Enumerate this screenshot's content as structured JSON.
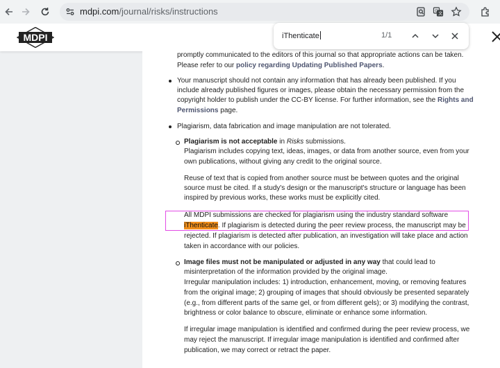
{
  "browser": {
    "url_host": "mdpi.com",
    "url_path": "/journal/risks/instructions",
    "icons": [
      "back-arrow-icon",
      "forward-arrow-icon",
      "reload-icon",
      "site-info-icon",
      "page-search-icon",
      "translate-icon",
      "bookmark-star-icon",
      "extensions-puzzle-icon"
    ]
  },
  "site": {
    "logo_text": "MDPI"
  },
  "find_bar": {
    "query": "iThenticate",
    "count": "1/1"
  },
  "content": {
    "p0_l1": "promptly communicated to the editors of this journal so that appropriate actions can be taken.",
    "p0_l2_pre": "Please refer to our ",
    "p0_l2_link": "policy regarding Updating Published Papers",
    "p0_l2_post": ".",
    "b1_l1": "Your manuscript should not contain any information that has already been published. If you",
    "b1_l2": "include already published figures or images, please obtain the necessary permission from the",
    "b1_l3_pre": "copyright holder to publish under the CC-BY license. For further information, see the ",
    "b1_l3_link": "Rights and",
    "b1_l4_link": "Permissions",
    "b1_l4_post": " page.",
    "b2_l1": "Plagiarism, data fabrication and image manipulation are not tolerated.",
    "s1_l1_bold": "Plagiarism is not acceptable",
    "s1_l1_mid": " in ",
    "s1_l1_ital": "Risks",
    "s1_l1_post": " submissions.",
    "s1_l2": "Plagiarism includes copying text, ideas, images, or data from another source, even from your",
    "s1_l3": "own publications, without giving any credit to the original source.",
    "s1_p2_l1": "Reuse of text that is copied from another source must be between quotes and the original",
    "s1_p2_l2": "source must be cited. If a study's design or the manuscript's structure or language has been",
    "s1_p2_l3": "inspired by previous works, these works must be explicitly cited.",
    "s1_p3_l1": "All MDPI submissions are checked for plagiarism using the industry standard software",
    "s1_p3_l2_match": "iThenticate",
    "s1_p3_l2_post": ". If plagiarism is detected during the peer review process, the manuscript may be",
    "s1_p3_l3": "rejected. If plagiarism is detected after publication, an investigation will take place and action",
    "s1_p3_l4": "taken in accordance with our policies.",
    "s2_l1_bold": "Image files must not be manipulated or adjusted in any way",
    "s2_l1_post": " that could lead to",
    "s2_l2": "misinterpretation of the information provided by the original image.",
    "s2_l3": "Irregular manipulation includes: 1) introduction, enhancement, moving, or removing features",
    "s2_l4": "from the original image; 2) grouping of images that should obviously be presented separately",
    "s2_l5": "(e.g., from different parts of the same gel, or from different gels); or 3) modifying the contrast,",
    "s2_l6": "brightness or color balance to obscure, eliminate or enhance some information.",
    "s2_p2_l1": "If irregular image manipulation is identified and confirmed during the peer review process, we",
    "s2_p2_l2": "may reject the manuscript. If irregular image manipulation is identified and confirmed after",
    "s2_p2_l3": "publication, we may correct or retract the paper."
  },
  "colors": {
    "find_match": "#f18f1b",
    "find_outline": "#e24be5",
    "link": "#4f5671"
  }
}
